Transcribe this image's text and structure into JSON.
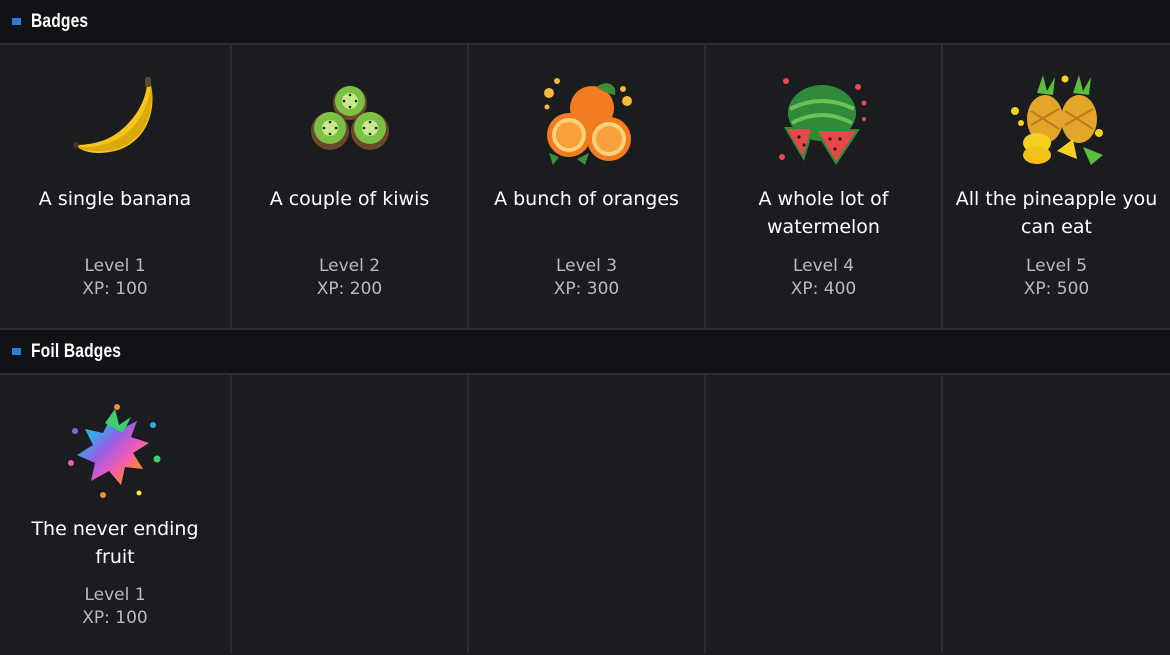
{
  "badges_section": {
    "title": "Badges"
  },
  "badges": [
    {
      "name": "A single banana",
      "level": "Level 1",
      "xp": "XP: 100",
      "icon": "banana-icon"
    },
    {
      "name": "A couple of kiwis",
      "level": "Level 2",
      "xp": "XP: 200",
      "icon": "kiwi-icon"
    },
    {
      "name": "A bunch of oranges",
      "level": "Level 3",
      "xp": "XP: 300",
      "icon": "orange-icon"
    },
    {
      "name": "A whole lot of watermelon",
      "level": "Level 4",
      "xp": "XP: 400",
      "icon": "watermelon-icon"
    },
    {
      "name": "All the pineapple you can eat",
      "level": "Level 5",
      "xp": "XP: 500",
      "icon": "pineapple-icon"
    }
  ],
  "foil_section": {
    "title": "Foil Badges"
  },
  "foil_badges": [
    {
      "name": "The never ending fruit",
      "level": "Level 1",
      "xp": "XP: 100",
      "icon": "rainbow-fruit-icon"
    }
  ],
  "colors": {
    "accent": "#2e7bd6",
    "background": "#1b1c20",
    "header": "#111216"
  }
}
